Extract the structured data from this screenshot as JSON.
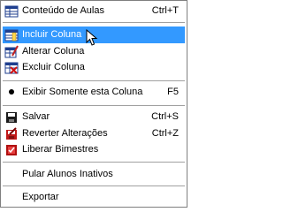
{
  "menu": {
    "items": [
      {
        "label": "Conteúdo de Aulas",
        "shortcut": "Ctrl+T"
      },
      {
        "label": "Incluir Coluna",
        "shortcut": ""
      },
      {
        "label": "Alterar Coluna",
        "shortcut": ""
      },
      {
        "label": "Excluir Coluna",
        "shortcut": ""
      },
      {
        "label": "Exibir Somente esta Coluna",
        "shortcut": "F5"
      },
      {
        "label": "Salvar",
        "shortcut": "Ctrl+S"
      },
      {
        "label": "Reverter Alterações",
        "shortcut": "Ctrl+Z"
      },
      {
        "label": "Liberar Bimestres",
        "shortcut": ""
      },
      {
        "label": "Pular Alunos Inativos",
        "shortcut": ""
      },
      {
        "label": "Exportar",
        "shortcut": ""
      }
    ]
  },
  "colors": {
    "highlight": "#3399ff",
    "separator": "#a0a0a0",
    "border": "#7f7f7f"
  }
}
